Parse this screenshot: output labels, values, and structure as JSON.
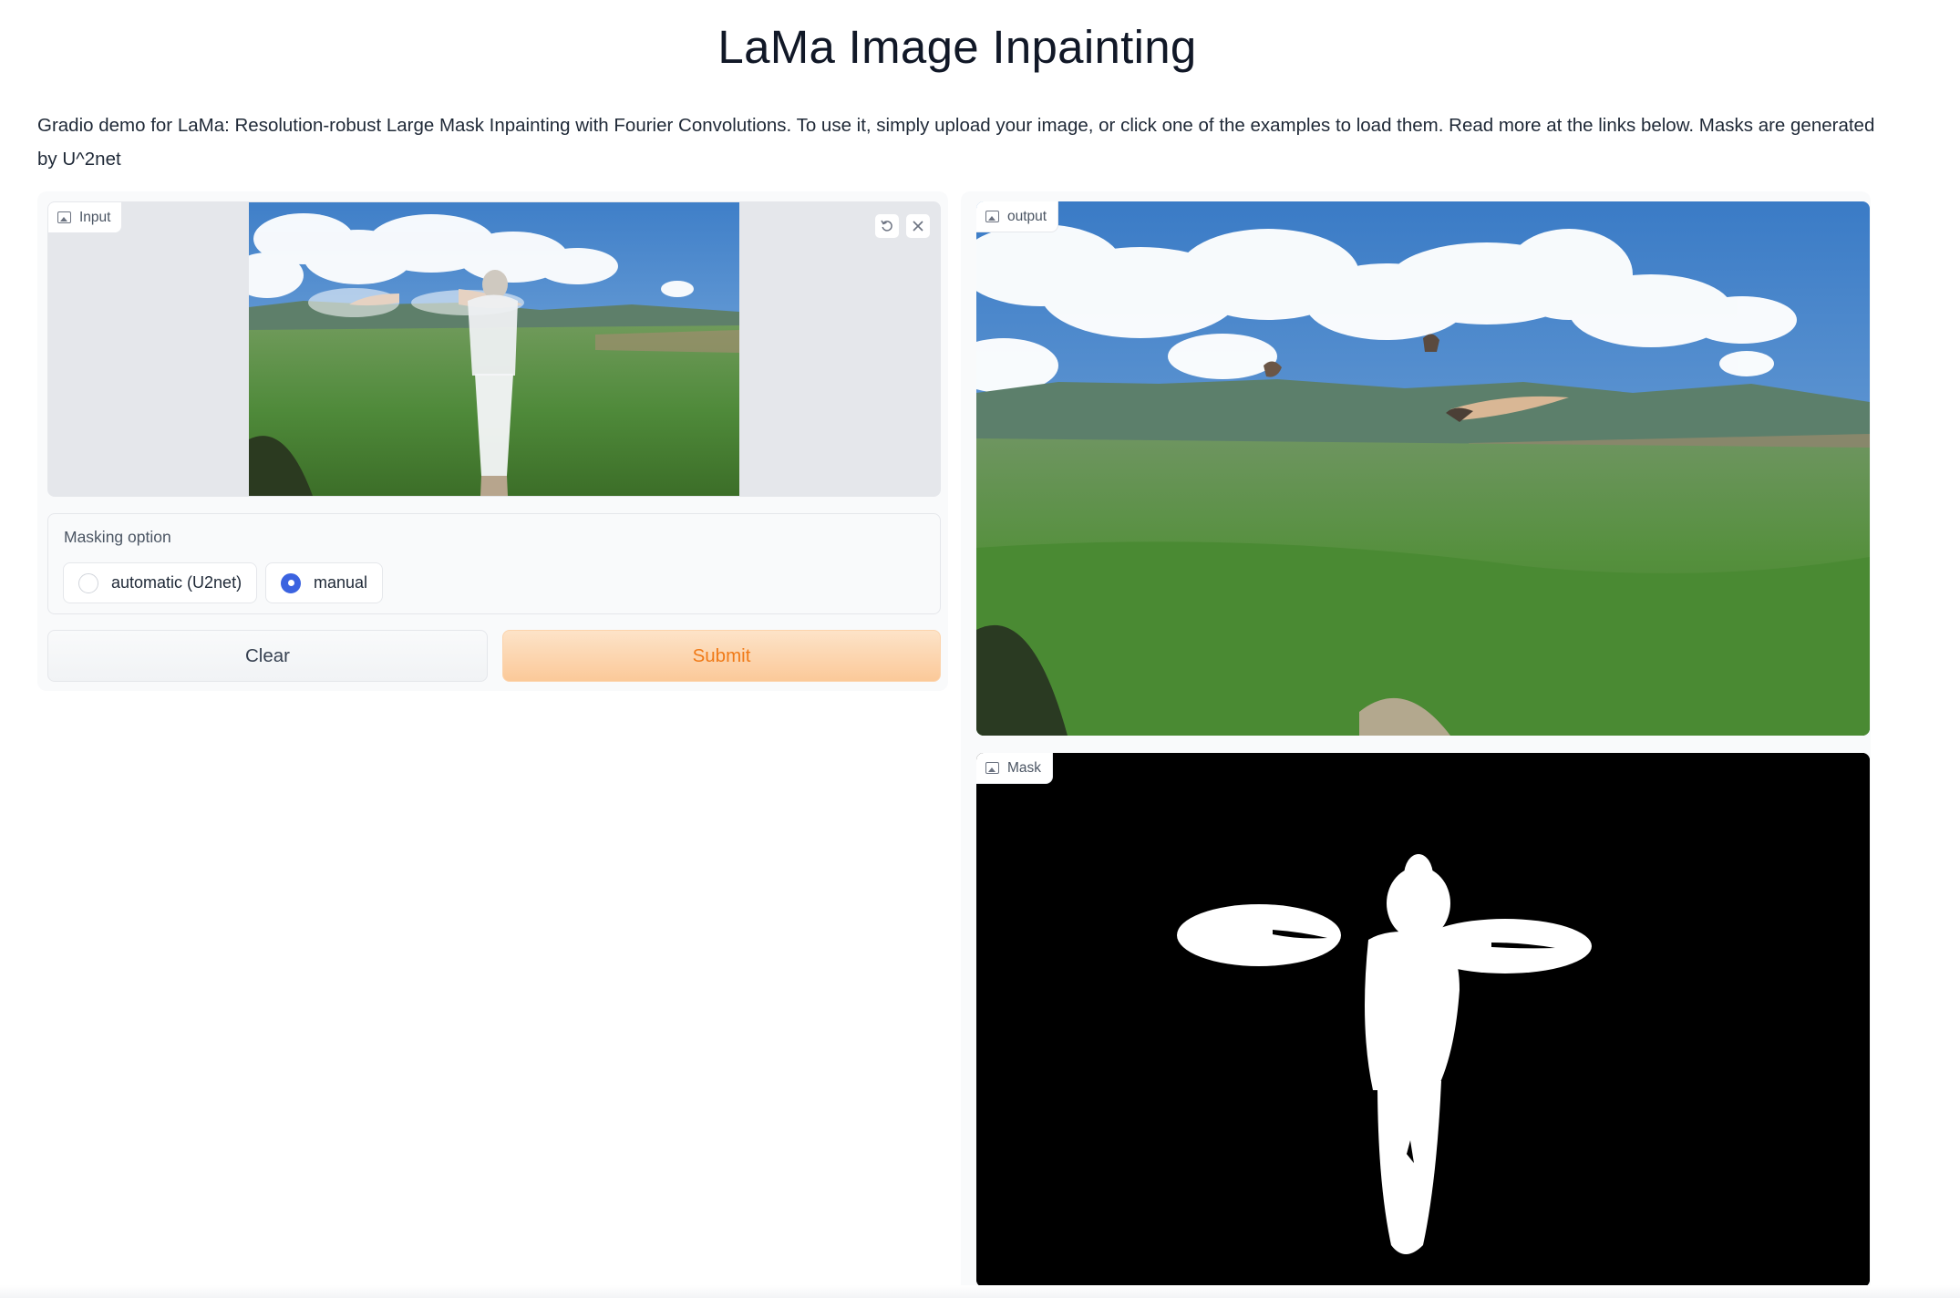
{
  "page": {
    "title": "LaMa Image Inpainting",
    "description": "Gradio demo for LaMa: Resolution-robust Large Mask Inpainting with Fourier Convolutions. To use it, simply upload your image, or click one of the examples to load them. Read more at the links below. Masks are generated by U^2net"
  },
  "input_panel": {
    "label": "Input",
    "label_icon": "image-icon",
    "undo_icon": "undo-icon",
    "clear_icon": "close-icon"
  },
  "masking": {
    "label": "Masking option",
    "options": [
      {
        "label": "automatic (U2net)",
        "selected": false
      },
      {
        "label": "manual",
        "selected": true
      }
    ]
  },
  "buttons": {
    "clear": "Clear",
    "submit": "Submit"
  },
  "output_panel": {
    "label": "output",
    "label_icon": "image-icon"
  },
  "mask_panel": {
    "label": "Mask",
    "label_icon": "image-icon"
  },
  "colors": {
    "accent_orange": "#f07a17",
    "radio_blue": "#3b63e0",
    "panel_bg": "#f9fafb"
  }
}
